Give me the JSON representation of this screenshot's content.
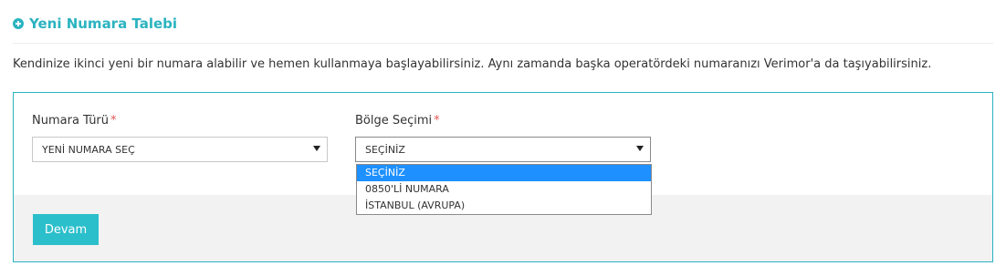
{
  "header": {
    "title": "Yeni Numara Talebi",
    "icon": "plus-circle-icon",
    "accent_color": "#2bb3c0"
  },
  "intro": "Kendinize ikinci yeni bir numara alabilir ve hemen kullanmaya başlayabilirsiniz. Aynı zamanda başka operatördeki numaranızı Verimor'a da taşıyabilirsiniz.",
  "form": {
    "number_type": {
      "label": "Numara Türü",
      "required_mark": "*",
      "value": "YENİ NUMARA SEÇ"
    },
    "region": {
      "label": "Bölge Seçimi",
      "required_mark": "*",
      "value": "SEÇİNİZ",
      "options": [
        "SEÇİNİZ",
        "0850'Lİ NUMARA",
        "İSTANBUL (AVRUPA)"
      ],
      "highlighted_index": 0
    },
    "submit_label": "Devam",
    "button_color": "#2bbfcb"
  }
}
